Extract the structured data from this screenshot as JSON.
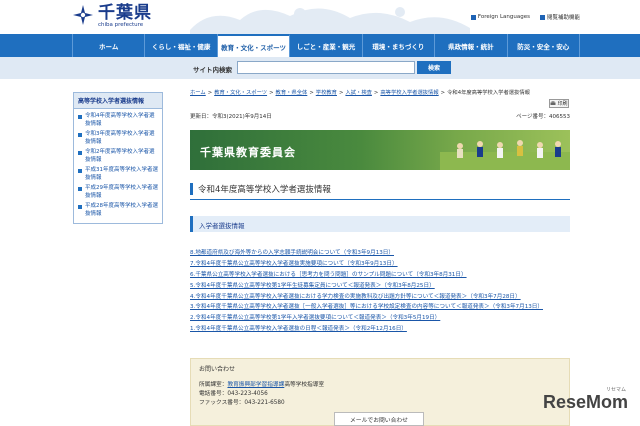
{
  "header": {
    "logo_text": "千葉県",
    "logo_sub": "chiba prefecture",
    "util_links": [
      "Foreign Languages",
      "閲覧補助機能"
    ]
  },
  "gnav": {
    "items": [
      "ホーム",
      "くらし・福祉・健康",
      "教育・文化・スポーツ",
      "しごと・産業・観光",
      "環境・まちづくり",
      "県政情報・統計",
      "防災・安全・安心"
    ]
  },
  "search": {
    "label": "サイト内検索",
    "placeholder": "",
    "button": "検索"
  },
  "sidebar": {
    "title": "高等学校入学者選抜情報",
    "items": [
      "令和4年度高等学校入学者選抜情報",
      "令和3年度高等学校入学者選抜情報",
      "令和2年度高等学校入学者選抜情報",
      "平成31年度高等学校入学者選抜情報",
      "平成29年度高等学校入学者選抜情報",
      "平成28年度高等学校入学者選抜情報"
    ]
  },
  "breadcrumb": {
    "crumbs": [
      "ホーム",
      "教育・文化・スポーツ",
      "教育・県全体",
      "学校教育",
      "入試・検査",
      "高等学校入学者選抜情報"
    ],
    "current": "令和4年度高等学校入学者選抜情報"
  },
  "print_label": "印刷",
  "meta": {
    "updated": "更新日：令和3(2021)年9月14日",
    "page_no": "ページ番号：406553"
  },
  "banner": {
    "title": "千葉県教育委員会"
  },
  "page_title": "令和4年度高等学校入学者選抜情報",
  "section_title": "入学者選抜情報",
  "news": [
    "8.地都道府県及び海外等からの入学志願手続説明会について（令和3年9月13日）",
    "7.令和4年度千葉県公立高等学校入学者選抜実施要項について（令和3年9月13日）",
    "6.千葉県公立高等学校入学者選抜における［思考力を問う問題］のサンプル問題について（令和3年8月31日）",
    "5.令和4年度千葉県公立高等学校第1学年生徒募集定員について＜報道発表＞（令和3年8月25日）",
    "4.令和4年度千葉県公立高等学校入学者選抜における学力検査の実施教科及び出題方針等について＜報道発表＞（令和3年7月28日）",
    "3.令和4年度千葉県公立高等学校入学者選抜［一般入学者選抜］等における学校設定検査の内容等について＜報道発表＞（令和3年7月13日）",
    "2.令和4年度千葉県公立高等学校第1学年入学者選抜要項について＜報道発表＞（令和3年5月19日）",
    "1.令和4年度千葉県公立高等学校入学者選抜の日程＜報道発表＞（令和2年12月16日）"
  ],
  "contact": {
    "head": "お問い合わせ",
    "dept_prefix": "所属課室：",
    "dept_link": "教育振興部学習指導課",
    "dept_suffix": "高等学校指導室",
    "phone": "電話番号：043-223-4056",
    "fax": "ファックス番号：043-221-6580",
    "mail_button": "メールでお問い合わせ"
  },
  "watermark": {
    "text": "ReseMom",
    "sub": "リセマム"
  },
  "colors": {
    "nav_blue": "#1f6fbf",
    "link_blue": "#1a56a8",
    "banner_green": "#4a8a3e"
  }
}
